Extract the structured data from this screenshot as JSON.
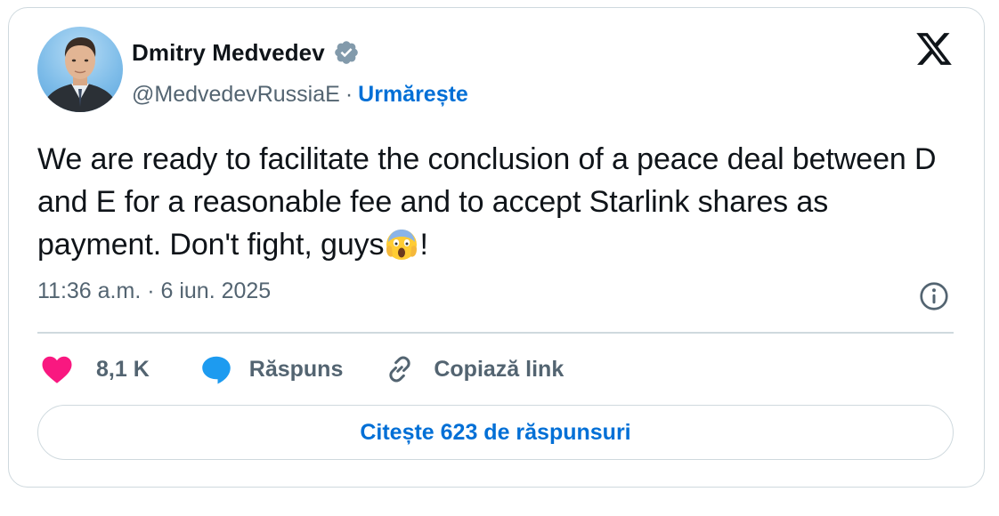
{
  "author": {
    "name": "Dmitry Medvedev",
    "handle": "@MedvedevRussiaE",
    "separator": "·",
    "follow_label": "Urmărește"
  },
  "tweet": {
    "text": "We are ready to facilitate the conclusion of a peace deal between D and E for a reasonable fee and to accept Starlink shares as payment. Don't fight, guys",
    "emoji": "face-screaming-in-fear",
    "text_end": "!",
    "timestamp": "11:36 a.m. · 6 iun. 2025"
  },
  "actions": {
    "likes": "8,1 K",
    "reply_label": "Răspuns",
    "copy_label": "Copiază link"
  },
  "read_replies_label": "Citește 623 de răspunsuri",
  "colors": {
    "accent": "#006fd6",
    "text": "#0f1419",
    "muted": "#536471",
    "border": "#cfd9de",
    "like": "#f91880",
    "reply": "#1d9bf0",
    "verified": "#829aab"
  },
  "icons": [
    "verified-badge-icon",
    "x-logo-icon",
    "info-icon",
    "heart-icon",
    "reply-bubble-icon",
    "link-icon"
  ]
}
